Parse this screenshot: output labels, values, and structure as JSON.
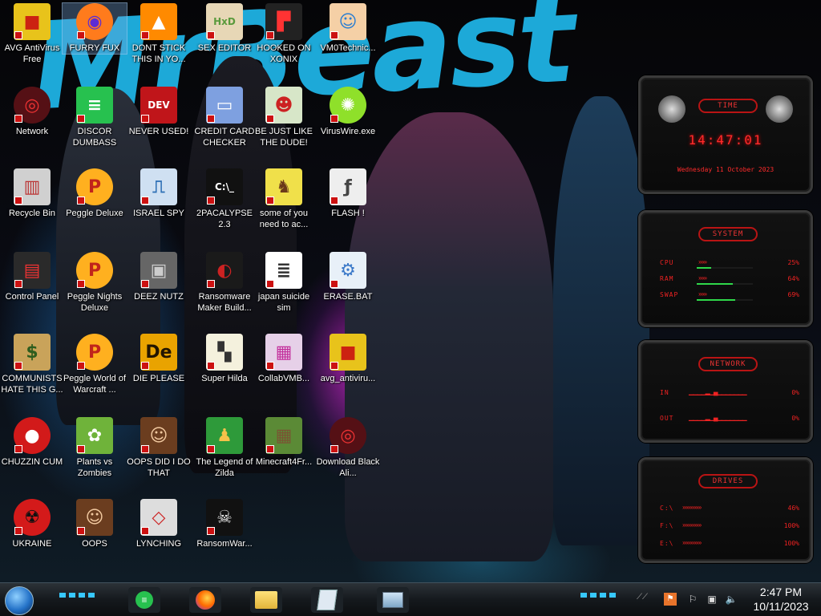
{
  "wallpaper": {
    "title_text": "MrBeast"
  },
  "desktop_icons": [
    {
      "label": "AVG AntiVirus Free",
      "icon": "avg-icon",
      "selected": false
    },
    {
      "label": "FURRY FUX",
      "icon": "firefox-icon",
      "selected": true
    },
    {
      "label": "DONT STICK THIS IN YO...",
      "icon": "vlc-icon",
      "selected": false
    },
    {
      "label": "SEX EDITOR",
      "icon": "hxd-icon",
      "selected": false
    },
    {
      "label": "HOOKED ON XONIX",
      "icon": "xonix-icon",
      "selected": false
    },
    {
      "label": "VM0Technic...",
      "icon": "technician-icon",
      "selected": false
    },
    {
      "label": "Network",
      "icon": "network-icon",
      "selected": false
    },
    {
      "label": "DISCOR DUMBASS",
      "icon": "discord-icon",
      "selected": false
    },
    {
      "label": "NEVER USED!",
      "icon": "devcpp-icon",
      "selected": false
    },
    {
      "label": "CREDIT CARD CHECKER",
      "icon": "credit-card-icon",
      "selected": false
    },
    {
      "label": "BE JUST LIKE THE DUDE!",
      "icon": "santa-icon",
      "selected": false
    },
    {
      "label": "VirusWire.exe",
      "icon": "lime-icon",
      "selected": false
    },
    {
      "label": "Recycle Bin",
      "icon": "recycle-bin-icon",
      "selected": false
    },
    {
      "label": "Peggle Deluxe",
      "icon": "peggle-icon",
      "selected": false
    },
    {
      "label": "ISRAEL SPY",
      "icon": "network-card-icon",
      "selected": false
    },
    {
      "label": "2PACALYPSE 2.3",
      "icon": "terminal-icon",
      "selected": false
    },
    {
      "label": "some of you need to ac...",
      "icon": "beaver-icon",
      "selected": false
    },
    {
      "label": "FLASH !",
      "icon": "flash-icon",
      "selected": false
    },
    {
      "label": "Control Panel",
      "icon": "control-panel-icon",
      "selected": false
    },
    {
      "label": "Peggle Nights Deluxe",
      "icon": "peggle-icon",
      "selected": false
    },
    {
      "label": "DEEZ NUTZ",
      "icon": "windows-stack-icon",
      "selected": false
    },
    {
      "label": "Ransomware Maker Build...",
      "icon": "ransomware-icon",
      "selected": false
    },
    {
      "label": "japan suicide sim",
      "icon": "document-icon",
      "selected": false
    },
    {
      "label": "ERASE.BAT",
      "icon": "gear-file-icon",
      "selected": false
    },
    {
      "label": "COMMUNISTS HATE THIS G...",
      "icon": "money-bag-icon",
      "selected": false
    },
    {
      "label": "Peggle World of Warcraft ...",
      "icon": "peggle-icon",
      "selected": false
    },
    {
      "label": "DIE PLEASE",
      "icon": "de-icon",
      "selected": false
    },
    {
      "label": "Super Hilda",
      "icon": "pixel-icon",
      "selected": false
    },
    {
      "label": "CollabVMB...",
      "icon": "collabvm-icon",
      "selected": false
    },
    {
      "label": "avg_antiviru...",
      "icon": "avg-icon",
      "selected": false
    },
    {
      "label": "CHUZZIN CUM",
      "icon": "chuzzle-icon",
      "selected": false
    },
    {
      "label": "Plants vs Zombies",
      "icon": "pvz-icon",
      "selected": false
    },
    {
      "label": "OOPS DID I DO THAT",
      "icon": "portrait-icon",
      "selected": false
    },
    {
      "label": "The Legend of Zilda",
      "icon": "zelda-icon",
      "selected": false
    },
    {
      "label": "Minecraft4Fr...",
      "icon": "minecraft-icon",
      "selected": false
    },
    {
      "label": "Download Black Ali...",
      "icon": "alienware-icon",
      "selected": false
    },
    {
      "label": "UKRAINE",
      "icon": "radiation-icon",
      "selected": false
    },
    {
      "label": "OOPS",
      "icon": "portrait-icon",
      "selected": false
    },
    {
      "label": "LYNCHING",
      "icon": "lynching-icon",
      "selected": false
    },
    {
      "label": "RansomWar...",
      "icon": "skull-icon",
      "selected": false
    }
  ],
  "widgets": {
    "time": {
      "title": "TIME",
      "clock": "14:47:01",
      "date": "Wednesday 11 October 2023"
    },
    "system": {
      "title": "SYSTEM",
      "rows": [
        {
          "label": "CPU",
          "value": "25%",
          "level": 0.25
        },
        {
          "label": "RAM",
          "value": "64%",
          "level": 0.64
        },
        {
          "label": "SWAP",
          "value": "69%",
          "level": 0.69
        }
      ]
    },
    "network": {
      "title": "NETWORK",
      "rows": [
        {
          "label": "IN",
          "value": "0%"
        },
        {
          "label": "OUT",
          "value": "0%"
        }
      ]
    },
    "drives": {
      "title": "DRIVES",
      "rows": [
        {
          "label": "C:\\",
          "value": "46%"
        },
        {
          "label": "F:\\",
          "value": "100%"
        },
        {
          "label": "E:\\",
          "value": "100%"
        }
      ]
    }
  },
  "taskbar": {
    "start_icon": "start-orb-icon",
    "pinned": [
      "discord-icon",
      "firefox-icon",
      "file-explorer-icon",
      "notepad-icon",
      "monitor-icon"
    ],
    "clock": {
      "time": "2:47 PM",
      "date": "10/11/2023"
    },
    "tray": [
      "flag-icon",
      "network-icon",
      "volume-icon",
      "keyboard-icon"
    ]
  }
}
